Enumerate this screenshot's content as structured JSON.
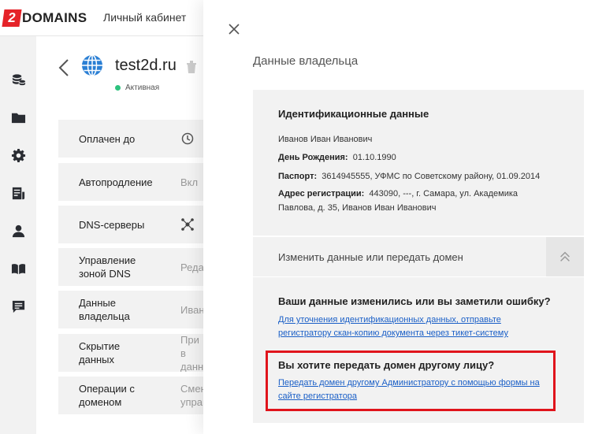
{
  "header": {
    "logo_number": "2",
    "logo_text": "DOMAINS",
    "cabinet_label": "Личный кабинет"
  },
  "rail": {
    "icons": [
      "coins-icon",
      "folder-icon",
      "gear-icon",
      "invoice-icon",
      "user-icon",
      "book-icon",
      "chat-icon"
    ]
  },
  "domain": {
    "name": "test2d.ru",
    "status": "Активная",
    "status_color": "#2ec27e"
  },
  "rows": [
    {
      "label": "Оплачен до",
      "value": "",
      "icon": "clock-icon"
    },
    {
      "label": "Автопродление",
      "value": "Вкл"
    },
    {
      "label": "DNS-серверы",
      "value": "",
      "icon": "network-icon"
    },
    {
      "label": "Управление зоной DNS",
      "value": "Реда"
    },
    {
      "label": "Данные владельца",
      "value": "Иван"
    },
    {
      "label": "Скрытие данных",
      "value": "При в данн"
    },
    {
      "label": "Операции с доменом",
      "value": "Смен управ"
    }
  ],
  "panel": {
    "title": "Данные владельца",
    "identity": {
      "heading": "Идентификационные данные",
      "full_name": "Иванов Иван Иванович",
      "birthday_label": "День Рождения:",
      "birthday_value": "01.10.1990",
      "passport_label": "Паспорт:",
      "passport_value": "3614945555, УФМС по Советскому району, 01.09.2014",
      "address_label": "Адрес регистрации:",
      "address_value_1": "443090, ---, г. Самара, ул. Академика",
      "address_value_2": "Павлова, д. 35, Иванов Иван Иванович"
    },
    "accordion_label": "Изменить данные или передать домен",
    "help": {
      "question_1": "Ваши данные изменились или вы заметили ошибку?",
      "link_1": "Для уточнения идентификационных данных, отправьте регистратору скан-копию документа через тикет-систему",
      "question_2": "Вы хотите передать домен другому лицу?",
      "link_2": "Передать домен другому Администратору с помощью формы на сайте регистратора"
    },
    "highlight_color": "#e0141c",
    "link_color": "#1a5fc7"
  }
}
